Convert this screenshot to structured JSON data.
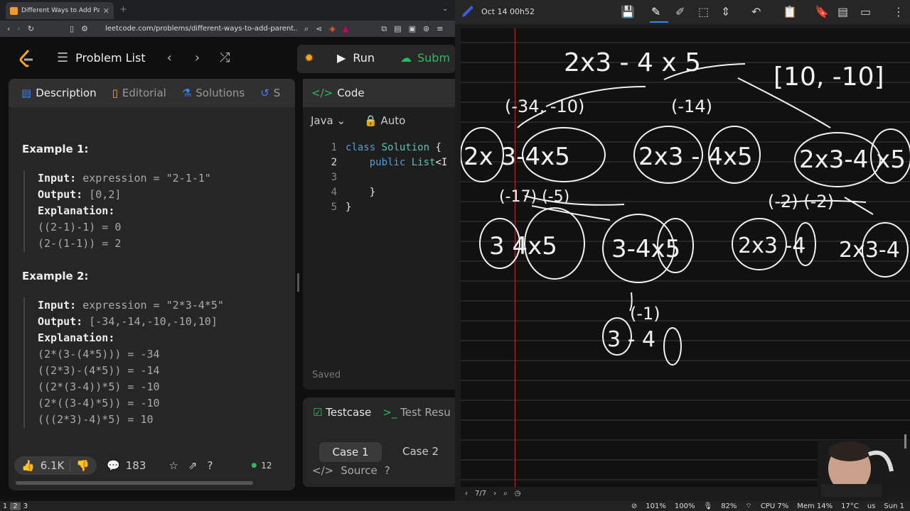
{
  "browser": {
    "tab_title": "Different Ways to Add Paren",
    "url": "leetcode.com/problems/different-ways-to-add-parent..."
  },
  "leetcode": {
    "problem_list_label": "Problem List",
    "run_label": "Run",
    "submit_label": "Subm",
    "desc_tabs": [
      "Description",
      "Editorial",
      "Solutions",
      "S"
    ],
    "examples": [
      {
        "title": "Example 1:",
        "input_label": "Input:",
        "input_value": "expression = \"2-1-1\"",
        "output_label": "Output:",
        "output_value": "[0,2]",
        "explanation_label": "Explanation:",
        "lines": [
          "((2-1)-1) = 0",
          "(2-(1-1)) = 2"
        ]
      },
      {
        "title": "Example 2:",
        "input_label": "Input:",
        "input_value": "expression = \"2*3-4*5\"",
        "output_label": "Output:",
        "output_value": "[-34,-14,-10,-10,10]",
        "explanation_label": "Explanation:",
        "lines": [
          "(2*(3-(4*5))) = -34",
          "((2*3)-(4*5)) = -14",
          "((2*(3-4))*5) = -10",
          "(2*((3-4)*5)) = -10",
          "(((2*3)-4)*5) = 10"
        ]
      }
    ],
    "likes": "6.1K",
    "comments": "183",
    "online_count": "12",
    "code_tab": "Code",
    "language": "Java",
    "auto_label": "Auto",
    "code_lines": [
      {
        "n": "1",
        "t": "class Solution {"
      },
      {
        "n": "2",
        "t": "    public List<I"
      },
      {
        "n": "3",
        "t": ""
      },
      {
        "n": "4",
        "t": "    }"
      },
      {
        "n": "5",
        "t": "}"
      }
    ],
    "saved_label": "Saved",
    "testcase_tab": "Testcase",
    "test_result_tab": "Test Resu",
    "case1": "Case 1",
    "case2": "Case 2",
    "source_label": "Source"
  },
  "notes": {
    "date": "Oct 14 00h52",
    "page_indicator": "7/7",
    "handwriting": {
      "top_expr": "2x3 - 4 x 5",
      "top_result": "[10, -10]",
      "left_result": "(-34, -10)",
      "mid_result": "(-14)",
      "left_group_split": "2x  3-4x5",
      "mid_group_split": "2x3 - 4x5",
      "right_group_split": "2x3-4 x5",
      "left_sub_results": "(-17) (-5)",
      "right_sub_results": "(-2) (-2)",
      "sub_a": "3  4x5",
      "sub_b": "3-4x5",
      "sub_c": "2x3 -4",
      "sub_d": "2x3-4",
      "bottom_result": "(-1)",
      "bottom_split": "3 - 4"
    }
  },
  "taskbar": {
    "workspaces": [
      "1",
      "2",
      "3"
    ],
    "active_workspace": "2",
    "volume": "101%",
    "brightness": "100%",
    "battery": "82%",
    "cpu": "CPU 7%",
    "mem": "Mem 14%",
    "temp": "17°C",
    "layout": "us",
    "day": "Sun 1"
  },
  "colors": {
    "accent_green": "#2cbb5d",
    "accent_orange": "#f5a623",
    "margin_line": "#aa3333"
  }
}
